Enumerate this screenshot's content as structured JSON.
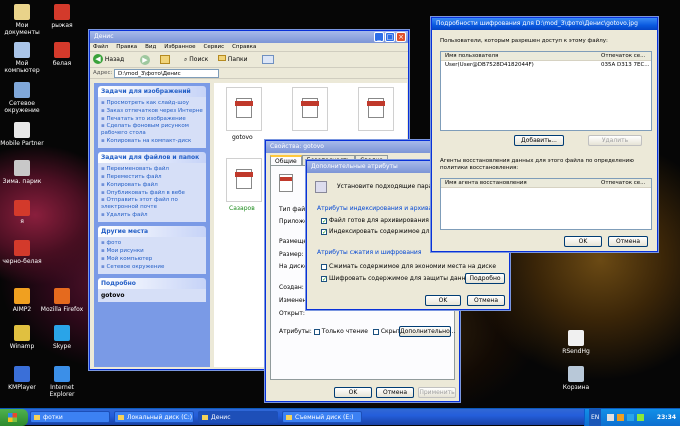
{
  "desktop_icons": [
    {
      "label": "Мои документы",
      "color": "#e9d38a"
    },
    {
      "label": "рыжая",
      "color": "#d33a2b"
    },
    {
      "label": "Мой компьютер",
      "color": "#a9c4e8"
    },
    {
      "label": "белая",
      "color": "#d33a2b"
    },
    {
      "label": "Сетевое окружение",
      "color": "#7fa7d9"
    },
    {
      "label": "Mobile Partner",
      "color": "#e8e8e8"
    },
    {
      "label": "Зима. парик",
      "color": "#c8c8c8"
    },
    {
      "label": "я",
      "color": "#d33a2b"
    },
    {
      "label": "черно-белая",
      "color": "#d33a2b"
    },
    {
      "label": "AIMP2",
      "color": "#f0a020"
    },
    {
      "label": "Mozilla Firefox",
      "color": "#e56a1e"
    },
    {
      "label": "Winamp",
      "color": "#e0c040"
    },
    {
      "label": "Skype",
      "color": "#2aa4e8"
    },
    {
      "label": "KMPlayer",
      "color": "#3a6fd8"
    },
    {
      "label": "Internet Explorer",
      "color": "#3b8fe8"
    },
    {
      "label": "RSendHg",
      "color": "#f0f0f0"
    },
    {
      "label": "Корзина",
      "color": "#b8c8d8"
    }
  ],
  "explorer": {
    "title": "Денис",
    "menu": [
      "Файл",
      "Правка",
      "Вид",
      "Избранное",
      "Сервис",
      "Справка"
    ],
    "back": "Назад",
    "search": "Поиск",
    "folders": "Папки",
    "address_label": "Адрес:",
    "address": "D:\\mod_3\\фото\\Денис",
    "tasks_images": {
      "title": "Задачи для изображений",
      "items": [
        "Просмотреть как слайд-шоу",
        "Заказ отпечатков через Интернет",
        "Печатать это изображение",
        "Сделать фоновым рисунком рабочего стола",
        "Копировать на компакт-диск"
      ]
    },
    "tasks_files": {
      "title": "Задачи для файлов и папок",
      "items": [
        "Переименовать файл",
        "Переместить файл",
        "Копировать файл",
        "Опубликовать файл в вебе",
        "Отправить этот файл по электронной почте",
        "Удалить файл"
      ]
    },
    "other_places": {
      "title": "Другие места",
      "items": [
        "фото",
        "Мои рисунки",
        "Мой компьютер",
        "Сетевое окружение"
      ]
    },
    "details_title": "Подробно",
    "details_name": "gotovo",
    "files": [
      "gotovo",
      "Сазаров"
    ]
  },
  "props": {
    "title": "Свойства: gotovo",
    "tabs": [
      "Общие",
      "Безопасность",
      "Сводка"
    ],
    "rows": [
      "Тип файла:",
      "Приложение:",
      "Размещение:",
      "Размер:",
      "На диске:",
      "Создан:",
      "Изменен:",
      "Открыт:"
    ],
    "attributes_label": "Атрибуты:",
    "readonly": "Только чтение",
    "hidden": "Скрытый",
    "advanced": "Дополнительно...",
    "ok": "OK",
    "cancel": "Отмена",
    "apply": "Применить"
  },
  "advanced": {
    "title": "Дополнительные атрибуты",
    "prompt": "Установите подходящие параметры",
    "group1": "Атрибуты индексирования и архивации",
    "chk1": "Файл готов для архивирования",
    "chk2": "Индексировать содержимое для быстр",
    "group2": "Атрибуты сжатия и шифрования",
    "chk3": "Сжимать содержимое для экономии места на диске",
    "chk4": "Шифровать содержимое для защиты данных",
    "details": "Подробно",
    "ok": "OK",
    "cancel": "Отмена"
  },
  "efs": {
    "title": "Подробности шифрования для D:\\mod_3\\фото\\Денис\\gotovo.jpg",
    "users_label": "Пользователи, которым разрешен доступ к этому файлу:",
    "col_user": "Имя пользователя",
    "col_thumb": "Отпечаток се...",
    "user": "User(User@DB7528D4182044F)",
    "thumb": "035A D313 7EC...",
    "add": "Добавить...",
    "remove": "Удалить",
    "agents_label": "Агенты восстановления данных для этого файла по определению политики восстановления:",
    "col_agent": "Имя агента восстановления",
    "col_thumb2": "Отпечаток се...",
    "ok": "OK",
    "cancel": "Отмена"
  },
  "taskbar": {
    "items": [
      "фотки",
      "Локальный диск (C:)",
      "Денис",
      "Съемный диск (E:)"
    ],
    "lang": "EN",
    "time": "23:34"
  }
}
